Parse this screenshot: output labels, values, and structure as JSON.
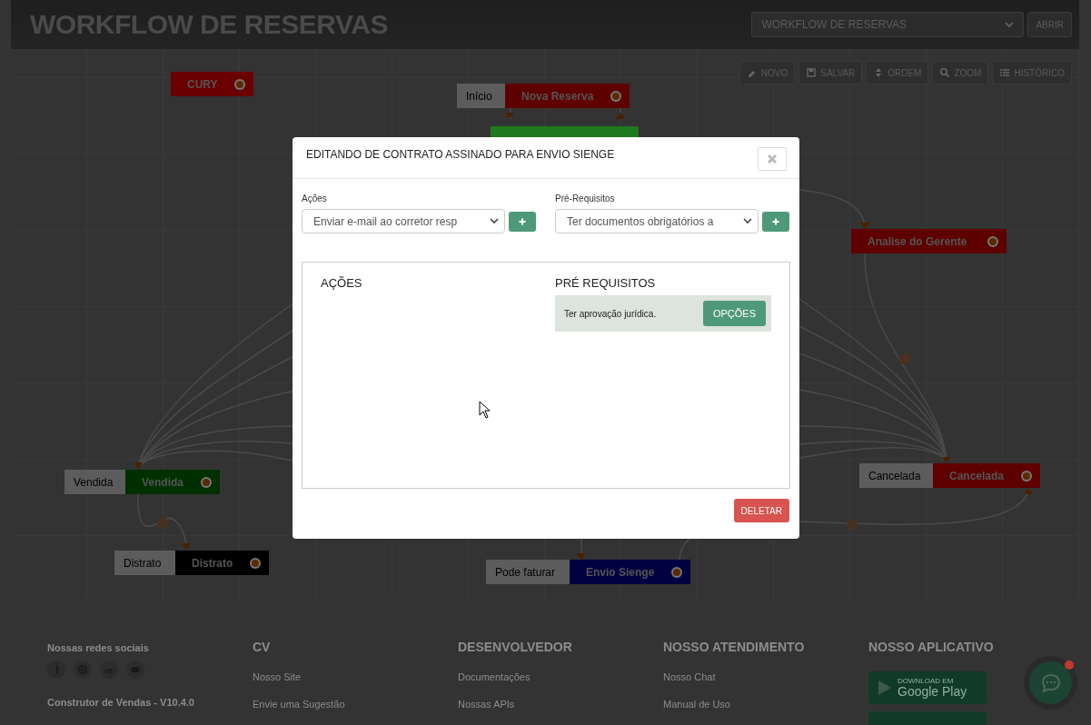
{
  "header": {
    "title": "WORKFLOW DE RESERVAS",
    "workflow_select": {
      "value": "WORKFLOW DE RESERVAS"
    },
    "open_button": "ABRIR"
  },
  "toolbar": [
    {
      "kind": "pencil",
      "label": "NOVO"
    },
    {
      "kind": "save",
      "label": "SALVAR"
    },
    {
      "kind": "sort",
      "label": "ORDEM"
    },
    {
      "kind": "search",
      "label": "ZOOM"
    },
    {
      "kind": "list",
      "label": "HISTÓRICO"
    }
  ],
  "canvas": {
    "nodes": [
      {
        "label": "CURY",
        "color": "#6a0000"
      },
      {
        "tag": "Início",
        "label": "Nova Reserva",
        "color": "#5e0000"
      },
      {
        "color": "#1e7a1e"
      },
      {
        "label": "Analise do Gerente",
        "color": "#5e0000"
      },
      {
        "tag": "Vendida",
        "label": "Vendida",
        "color": "#003000"
      },
      {
        "tag": "Cancelada",
        "label": "Cancelada",
        "color": "#5e0000"
      },
      {
        "tag": "Distrato",
        "label": "Distrato",
        "color": "#000000"
      },
      {
        "tag": "Pode faturar",
        "label": "Envio Sienge",
        "color": "#000040"
      }
    ]
  },
  "modal": {
    "title": "EDITANDO DE CONTRATO ASSINADO PARA ENVIO SIENGE",
    "fields": [
      {
        "label": "Ações",
        "value": "Enviar e-mail ao corretor resp"
      },
      {
        "label": "Pré-Requisitos",
        "value": "Ter documentos obrigatórios a"
      }
    ],
    "columns": [
      {
        "heading": "AÇÕES"
      },
      {
        "heading": "PRÉ REQUISITOS",
        "items": [
          {
            "text": "Ter aprovação jurídica.",
            "button": "OPÇÕES"
          }
        ]
      }
    ],
    "delete_button": "DELETAR"
  },
  "footer": {
    "social_heading": "Nossas redes sociais",
    "version": "Construtor de Vendas - V10.4.0",
    "columns": [
      {
        "heading": "CV",
        "links": [
          "Nosso Site",
          "Envie uma Sugestão"
        ]
      },
      {
        "heading": "DESENVOLVEDOR",
        "links": [
          "Documentações",
          "Nossas APIs"
        ]
      },
      {
        "heading": "NOSSO ATENDIMENTO",
        "links": [
          "Nosso Chat",
          "Manual de Uso"
        ]
      }
    ],
    "app": {
      "heading": "NOSSO APLICATIVO",
      "badge_small": "DOWNLOAD EM",
      "badge_big": "Google Play"
    }
  }
}
